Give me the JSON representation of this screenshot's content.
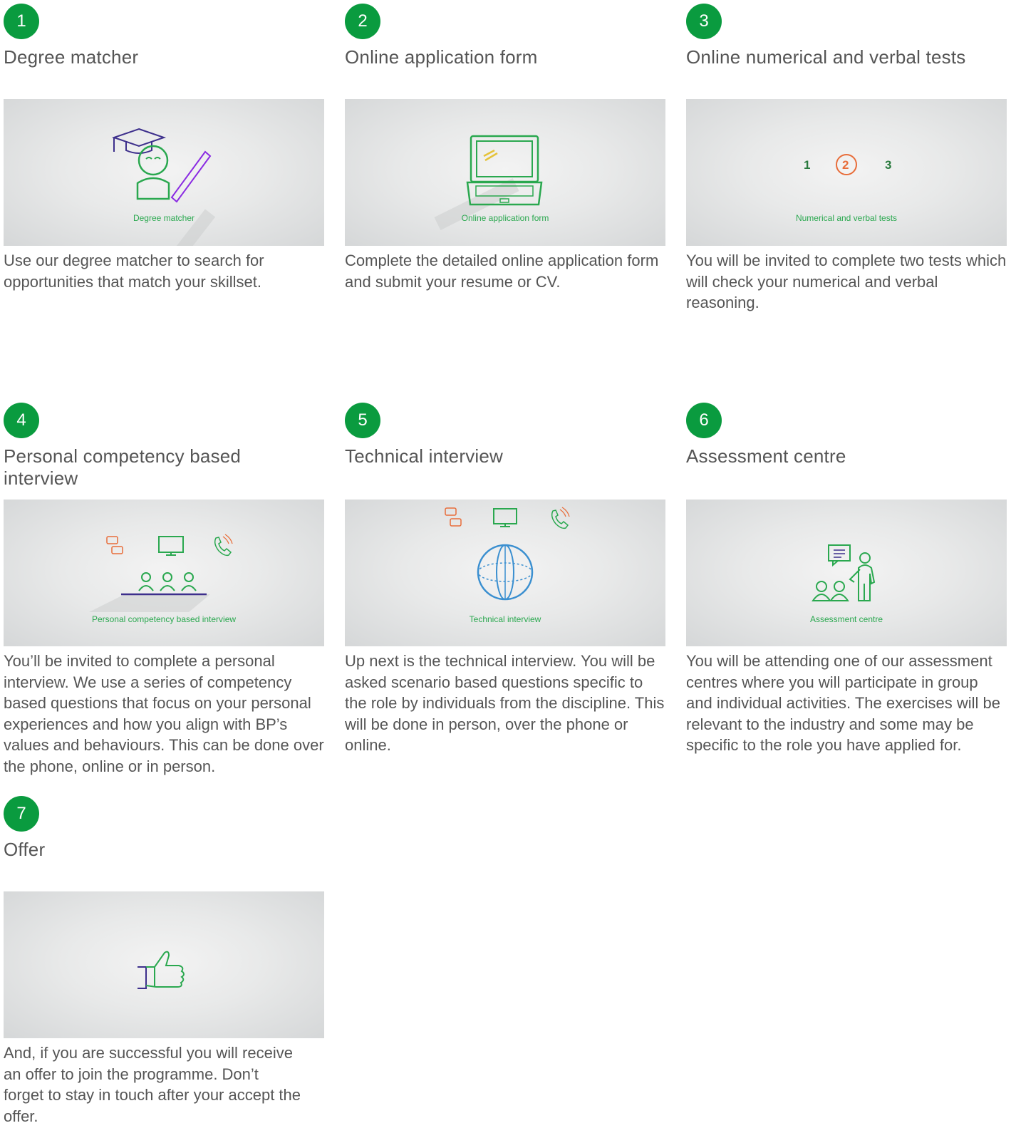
{
  "colors": {
    "badge": "#0a9b3f",
    "caption": "#2aa84f",
    "text": "#555555"
  },
  "steps": [
    {
      "number": "1",
      "title": "Degree matcher",
      "image_caption": "Degree matcher",
      "icon": "graduate-icon",
      "description": "Use our degree matcher to search for opportunities that match your skillset."
    },
    {
      "number": "2",
      "title": "Online application form",
      "image_caption": "Online application form",
      "icon": "laptop-icon",
      "description": "Complete the detailed online application form and submit your resume or CV."
    },
    {
      "number": "3",
      "title": "Online numerical and verbal tests",
      "image_caption": "Numerical and verbal tests",
      "icon": "numbers-icon",
      "image_numbers": [
        "1",
        "2",
        "3"
      ],
      "description": "You will be invited to complete two tests which will check your numerical and verbal reasoning."
    },
    {
      "number": "4",
      "title": "Personal competency based interview",
      "image_caption": "Personal competency based  interview",
      "icon": "interview-panel-icon",
      "description": "You’ll be invited to complete a personal interview. We use a series of competency based questions that focus on your personal experiences and how you align with BP’s values and behaviours. This can be done over the phone, online or in person."
    },
    {
      "number": "5",
      "title": "Technical interview",
      "image_caption": "Technical interview",
      "icon": "globe-icon",
      "description": "Up next is the technical interview. You will be asked scenario based questions specific to the role by individuals from the discipline. This will be done in person, over the phone or online."
    },
    {
      "number": "6",
      "title": "Assessment centre",
      "image_caption": "Assessment centre",
      "icon": "presenter-icon",
      "description": "You will be attending one of our assessment centres where you will participate in group and individual activities. The exercises will be relevant to the industry and some may be specific to the role you have applied for."
    },
    {
      "number": "7",
      "title": "Offer",
      "image_caption": "",
      "icon": "thumbs-up-icon",
      "description": "And, if you are successful you will receive an offer to join the programme. Don’t forget to stay in touch after your accept the offer."
    }
  ]
}
